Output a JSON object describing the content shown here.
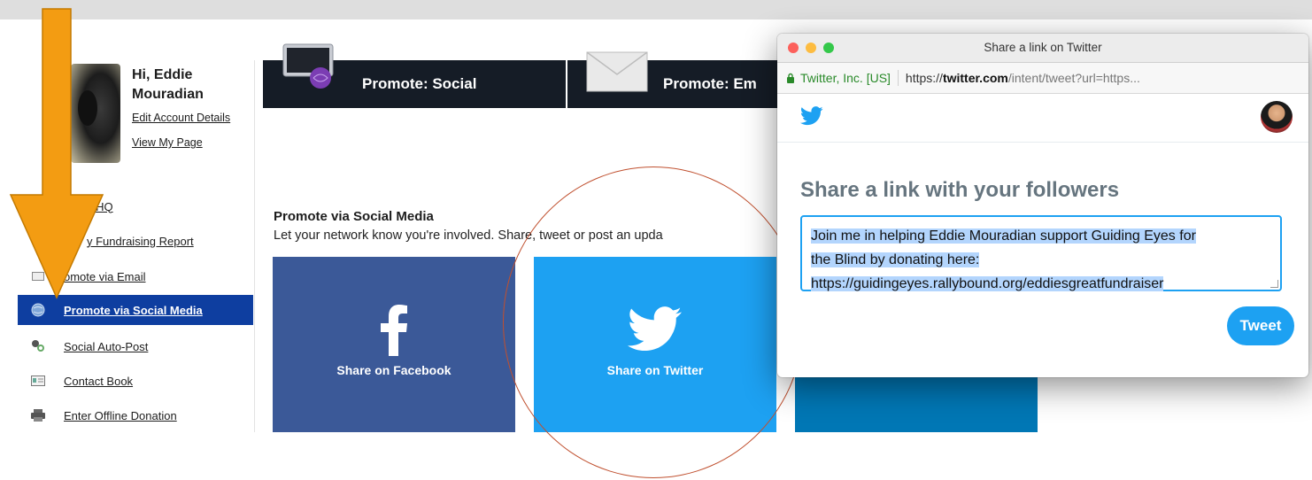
{
  "profile": {
    "greeting_line1": "Hi, Eddie",
    "greeting_line2": "Mouradian",
    "edit_account": "Edit Account Details",
    "view_page": "View My Page"
  },
  "nav": {
    "items": [
      {
        "label": "y HQ",
        "icon": "home-icon"
      },
      {
        "label": "y Fundraising Report",
        "icon": "report-icon"
      },
      {
        "label": "omote via Email",
        "icon": "envelope-icon"
      },
      {
        "label": "Promote via Social Media",
        "icon": "globe-icon",
        "active": true
      },
      {
        "label": "Social Auto-Post",
        "icon": "people-icon"
      },
      {
        "label": "Contact Book",
        "icon": "contact-card-icon"
      },
      {
        "label": "Enter Offline Donation",
        "icon": "printer-icon"
      }
    ]
  },
  "tabs": {
    "social": "Promote: Social",
    "email": "Promote: Em"
  },
  "section": {
    "title": "Promote via Social Media",
    "description": "Let your network know you're involved. Share, tweet or post an upda"
  },
  "cards": {
    "facebook": "Share on Facebook",
    "twitter": "Share on Twitter"
  },
  "popup": {
    "window_title": "Share a link on Twitter",
    "org": "Twitter, Inc. [US]",
    "url_scheme": "https://",
    "url_host": "twitter.com",
    "url_path": "/intent/tweet?url=https...",
    "heading": "Share a link with your followers",
    "tweet_line1": "Join me in helping Eddie Mouradian support Guiding Eyes for",
    "tweet_line2": "the Blind by donating here:",
    "tweet_line3": "https://guidingeyes.rallybound.org/eddiesgreatfundraiser",
    "tweet_button": "Tweet"
  },
  "colors": {
    "nav_active": "#0e3ea0",
    "facebook": "#3b5998",
    "twitter": "#1da1f2",
    "linkedin": "#0077b5",
    "arrow": "#f39c12",
    "circle": "#c0502f"
  }
}
